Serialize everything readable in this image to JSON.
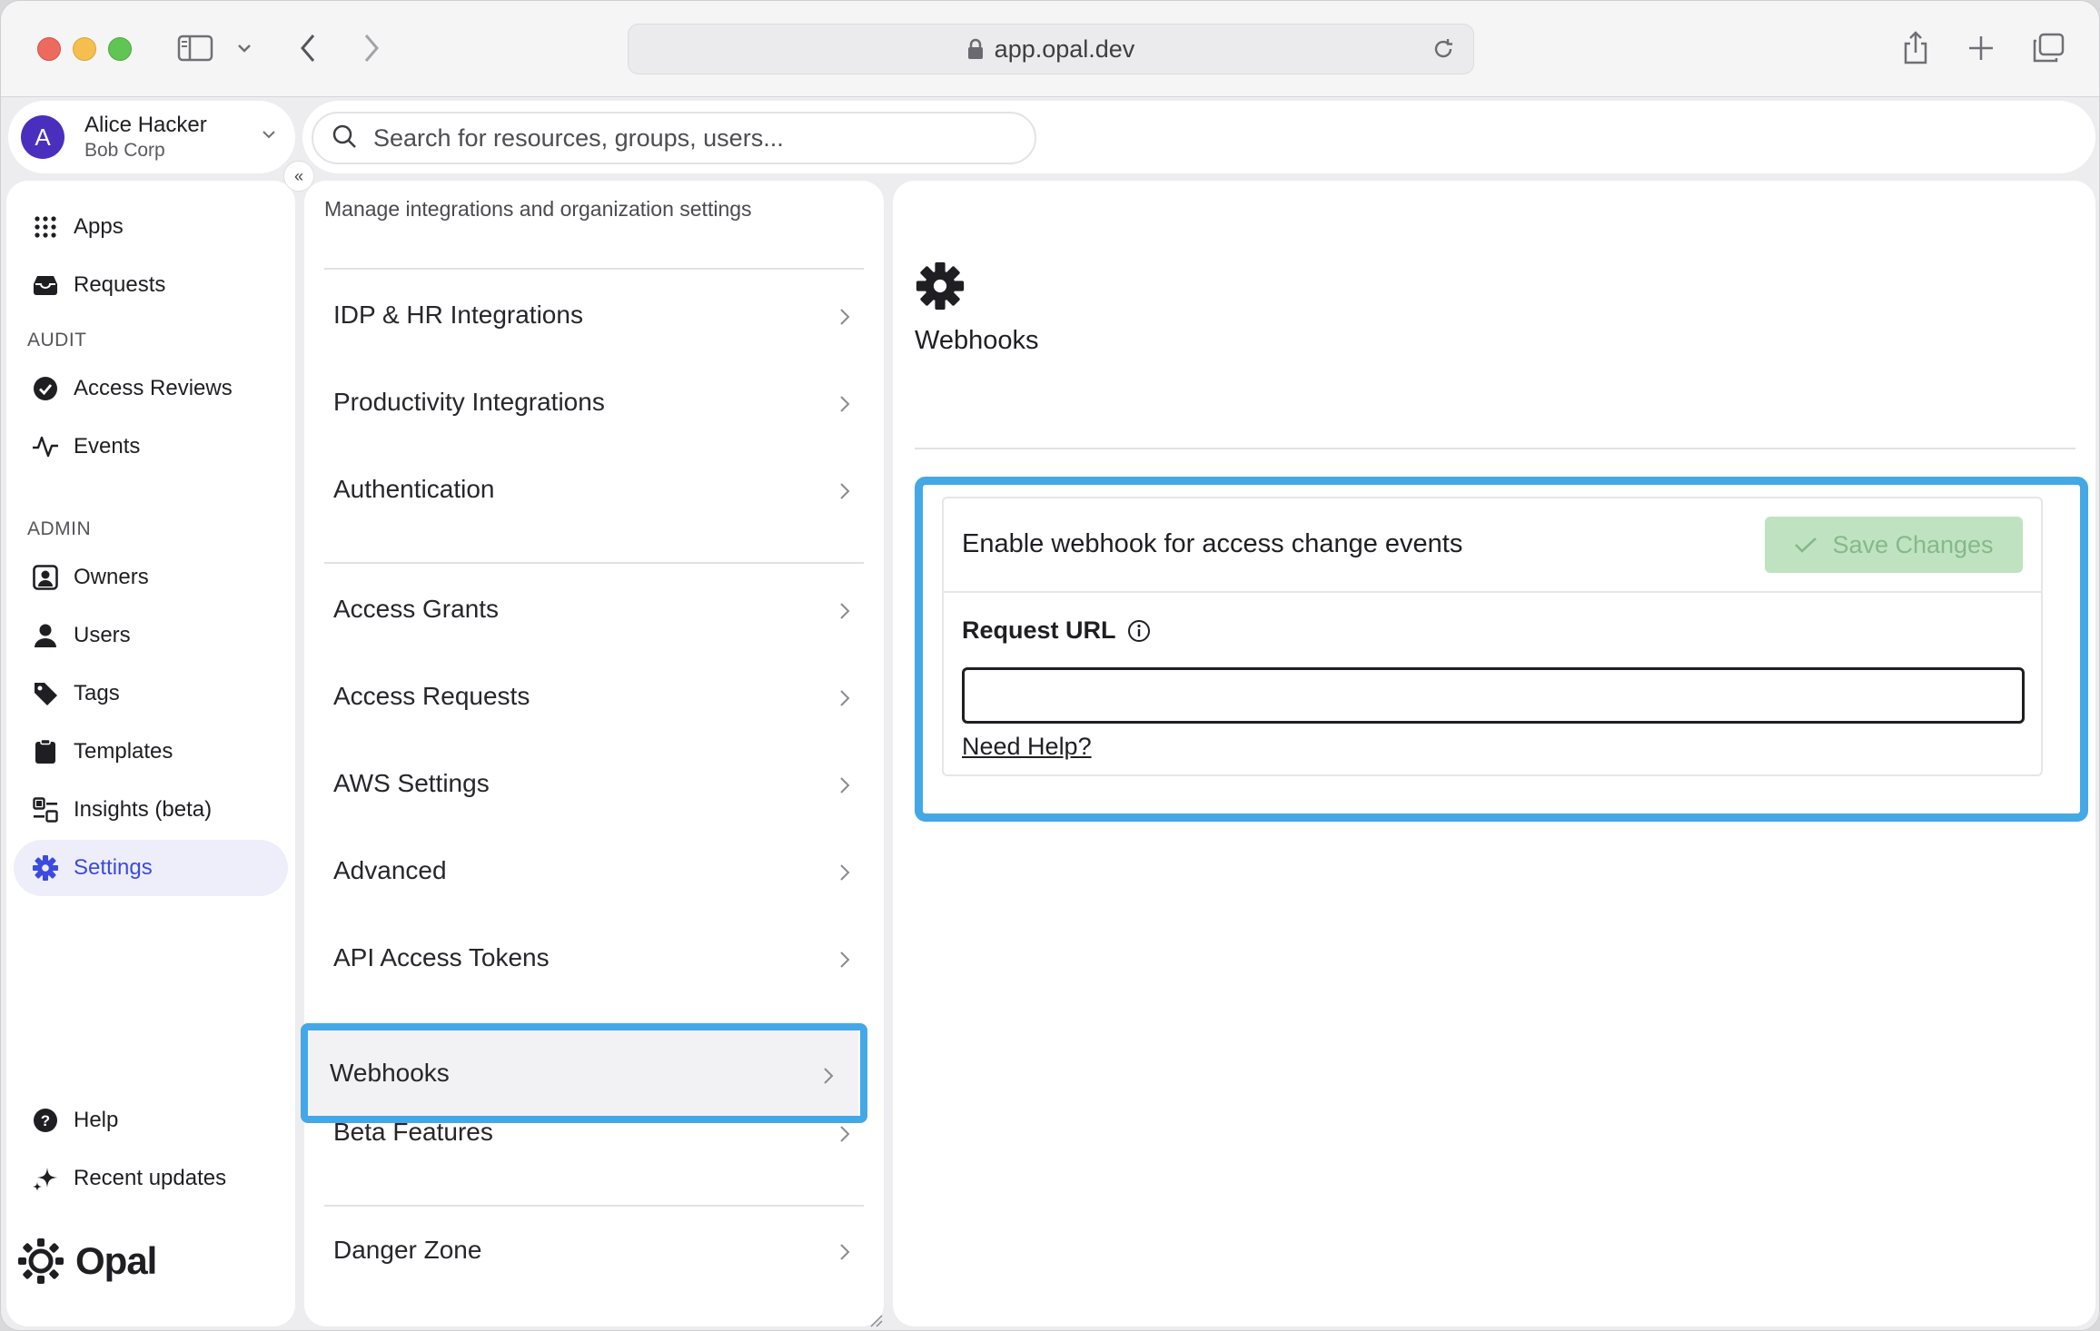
{
  "browser": {
    "url": "app.opal.dev"
  },
  "user": {
    "initial": "A",
    "name": "Alice Hacker",
    "org": "Bob Corp"
  },
  "search": {
    "placeholder": "Search for resources, groups, users..."
  },
  "sidebar": {
    "items_top": [
      {
        "label": "Apps",
        "icon": "grid-icon"
      },
      {
        "label": "Requests",
        "icon": "inbox-icon"
      }
    ],
    "audit_label": "AUDIT",
    "items_audit": [
      {
        "label": "Access Reviews",
        "icon": "check-circle-icon"
      },
      {
        "label": "Events",
        "icon": "pulse-icon"
      }
    ],
    "admin_label": "ADMIN",
    "items_admin": [
      {
        "label": "Owners",
        "icon": "owner-badge-icon"
      },
      {
        "label": "Users",
        "icon": "user-icon"
      },
      {
        "label": "Tags",
        "icon": "tag-icon"
      },
      {
        "label": "Templates",
        "icon": "clipboard-icon"
      },
      {
        "label": "Insights (beta)",
        "icon": "insights-icon"
      },
      {
        "label": "Settings",
        "icon": "gear-icon",
        "active": true
      }
    ],
    "items_bottom": [
      {
        "label": "Help",
        "icon": "help-icon"
      },
      {
        "label": "Recent updates",
        "icon": "sparkle-icon"
      }
    ],
    "brand": "Opal"
  },
  "settings_menu": {
    "subtitle": "Manage integrations and organization settings",
    "groups": [
      [
        "IDP & HR Integrations",
        "Productivity Integrations",
        "Authentication"
      ],
      [
        "Access Grants",
        "Access Requests",
        "AWS Settings",
        "Advanced",
        "API Access Tokens",
        "Webhooks",
        "Beta Features"
      ],
      [
        "Danger Zone"
      ]
    ],
    "selected": "Webhooks"
  },
  "webhooks": {
    "page_title": "Webhooks",
    "card_title": "Enable webhook for access change events",
    "save_label": "Save Changes",
    "field_label": "Request URL",
    "field_value": "",
    "help_link": "Need Help?"
  },
  "colors": {
    "accent": "#3b4ae0",
    "highlight": "#44a8e6",
    "save_disabled_bg": "#bfe3c0",
    "save_disabled_text": "#86b889"
  }
}
